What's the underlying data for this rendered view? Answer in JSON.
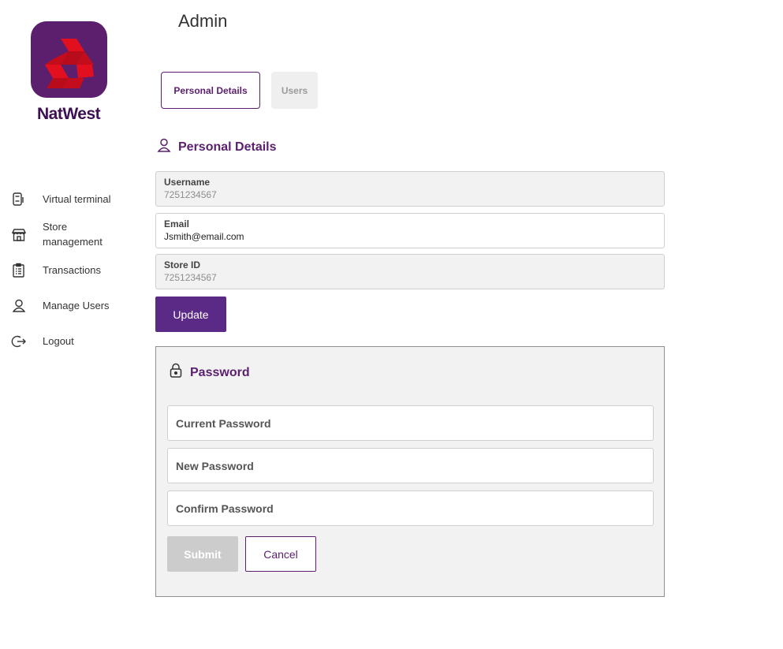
{
  "app": {
    "brand": "NatWest",
    "page_title": "Admin"
  },
  "colors": {
    "brand_purple": "#5b1f6e",
    "logo_red": "#e20f1f",
    "button_purple": "#5b2a86",
    "panel_bg": "#f2f2f2"
  },
  "sidebar": {
    "items": [
      {
        "label": "Virtual terminal",
        "icon": "card-terminal-icon"
      },
      {
        "label": "Store management",
        "icon": "store-icon"
      },
      {
        "label": "Transactions",
        "icon": "clipboard-icon"
      },
      {
        "label": "Manage Users",
        "icon": "user-icon"
      },
      {
        "label": "Logout",
        "icon": "logout-icon"
      }
    ]
  },
  "tabs": [
    {
      "label": "Personal Details",
      "active": true
    },
    {
      "label": "Users",
      "active": false
    }
  ],
  "personal": {
    "title": "Personal Details",
    "fields": [
      {
        "label": "Username",
        "value": "7251234567",
        "readonly": true
      },
      {
        "label": "Email",
        "value": "Jsmith@email.com",
        "readonly": false
      },
      {
        "label": "Store ID",
        "value": "7251234567",
        "readonly": true
      }
    ],
    "update_label": "Update"
  },
  "password": {
    "title": "Password",
    "current_placeholder": "Current Password",
    "new_placeholder": "New Password",
    "confirm_placeholder": "Confirm Password",
    "submit_label": "Submit",
    "cancel_label": "Cancel"
  }
}
